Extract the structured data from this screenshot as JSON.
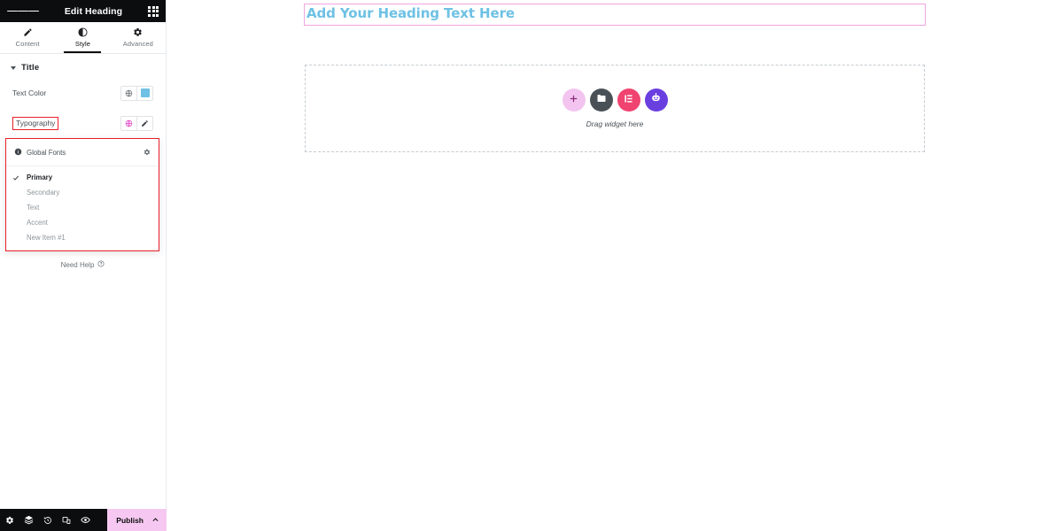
{
  "panel": {
    "header": {
      "title": "Edit Heading",
      "menu_icon": "hamburger-menu-icon",
      "apps_icon": "apps-grid-icon"
    },
    "tabs": [
      {
        "label": "Content",
        "icon": "pencil-icon",
        "active": false
      },
      {
        "label": "Style",
        "icon": "contrast-icon",
        "active": true
      },
      {
        "label": "Advanced",
        "icon": "gear-icon",
        "active": false
      }
    ],
    "section": {
      "title": "Title",
      "collapsed": false
    },
    "controls": [
      {
        "label": "Text Color",
        "global_icon": "globe-icon",
        "value_swatch": "#6ec1e4"
      },
      {
        "label": "Typography",
        "global_icon": "globe-icon-active",
        "edit_icon": "pencil-edit-icon",
        "highlighted": true
      }
    ],
    "popover": {
      "heading": "Global Fonts",
      "info_icon": "info-icon",
      "settings_icon": "gear-icon",
      "items": [
        {
          "label": "Primary",
          "selected": true
        },
        {
          "label": "Secondary",
          "selected": false
        },
        {
          "label": "Text",
          "selected": false
        },
        {
          "label": "Accent",
          "selected": false
        },
        {
          "label": "New Item #1",
          "selected": false
        }
      ]
    },
    "need_help": {
      "label": "Need Help",
      "icon": "question-circle-icon"
    },
    "collapse_handle": {
      "icon": "chevron-left-icon"
    },
    "footer": {
      "icons": [
        "settings-gear-icon",
        "navigator-layers-icon",
        "history-clock-icon",
        "responsive-mode-icon",
        "preview-eye-icon"
      ],
      "publish_label": "Publish",
      "publish_chevron_icon": "chevron-up-icon"
    }
  },
  "canvas": {
    "heading": {
      "text": "Add Your Heading Text Here",
      "color": "#6ec1e4"
    },
    "dropzone": {
      "caption": "Drag widget here",
      "buttons": [
        {
          "name": "add-element-button",
          "icon": "plus-icon",
          "color": "#f2c4ef"
        },
        {
          "name": "add-template-button",
          "icon": "folder-icon",
          "color": "#495157"
        },
        {
          "name": "elementor-widgets-button",
          "icon": "elementor-icon",
          "color": "#f0436f"
        },
        {
          "name": "ai-builder-button",
          "icon": "ai-robot-icon",
          "color": "#6a3fe0"
        }
      ]
    }
  },
  "theme": {
    "accent_pink": "#f6c8f1",
    "annotation_red": "#e8202a",
    "primary_blue": "#6ec1e4",
    "panel_dark": "#0c0d0e"
  }
}
